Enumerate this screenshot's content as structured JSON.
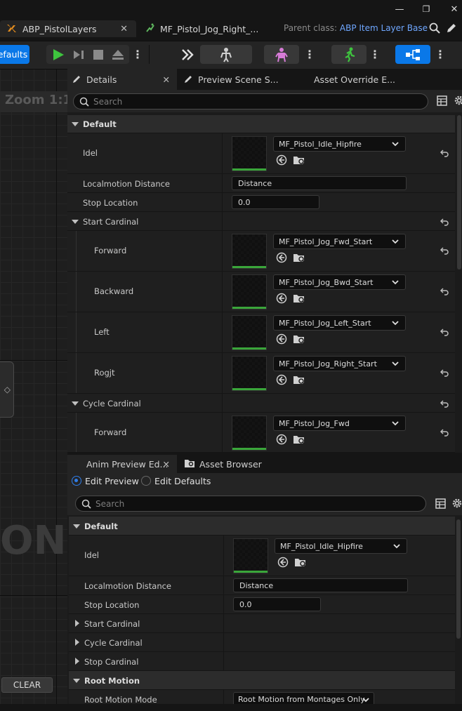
{
  "title_bar": {
    "tabs": [
      {
        "label": "ABP_PistolLayers",
        "active": true
      },
      {
        "label": "MF_Pistol_Jog_Right_...",
        "active": false
      }
    ],
    "parent_class_label": "Parent class:",
    "parent_class_value": "ABP Item Layer Base"
  },
  "toolbar": {
    "class_defaults_label": "efaults"
  },
  "graph": {
    "zoom_label": "Zoom 1:1",
    "watermark": "ON",
    "clear_button": "CLEAR"
  },
  "details_panel": {
    "tabs": [
      "Details",
      "Preview Scene S...",
      "Asset Override E..."
    ],
    "search_placeholder": "Search",
    "default_category": "Default",
    "idel_label": "Idel",
    "idel_asset": "MF_Pistol_Idle_Hipfire",
    "localmotion_label": "Localmotion Distance",
    "localmotion_value": "Distance",
    "stop_location_label": "Stop Location",
    "stop_location_value": "0.0",
    "start_cardinal": {
      "label": "Start Cardinal",
      "items": [
        {
          "label": "Forward",
          "asset": "MF_Pistol_Jog_Fwd_Start"
        },
        {
          "label": "Backward",
          "asset": "MF_Pistol_Jog_Bwd_Start"
        },
        {
          "label": "Left",
          "asset": "MF_Pistol_Jog_Left_Start"
        },
        {
          "label": "Rogjt",
          "asset": "MF_Pistol_Jog_Right_Start"
        }
      ]
    },
    "cycle_cardinal": {
      "label": "Cycle Cardinal",
      "items": [
        {
          "label": "Forward",
          "asset": "MF_Pistol_Jog_Fwd"
        }
      ]
    }
  },
  "preview_panel": {
    "tabs": [
      "Anim Preview Ed...",
      "Asset Browser"
    ],
    "radio_edit_preview": "Edit Preview",
    "radio_edit_defaults": "Edit Defaults",
    "search_placeholder": "Search",
    "default_category": "Default",
    "idel_label": "Idel",
    "idel_asset": "MF_Pistol_Idle_Hipfire",
    "localmotion_label": "Localmotion Distance",
    "localmotion_value": "Distance",
    "stop_location_label": "Stop Location",
    "stop_location_value": "0.0",
    "start_cardinal_label": "Start Cardinal",
    "cycle_cardinal_label": "Cycle Cardinal",
    "stop_cardinal_label": "Stop Cardinal",
    "root_motion_category": "Root Motion",
    "root_motion_mode_label": "Root Motion Mode",
    "root_motion_mode_value": "Root Motion from Montages Only"
  },
  "colors": {
    "accent_blue": "#0a78e8",
    "link_blue": "#6fa7ff",
    "play_green": "#3ec43e",
    "asset_bar_green": "#3aa63a"
  }
}
